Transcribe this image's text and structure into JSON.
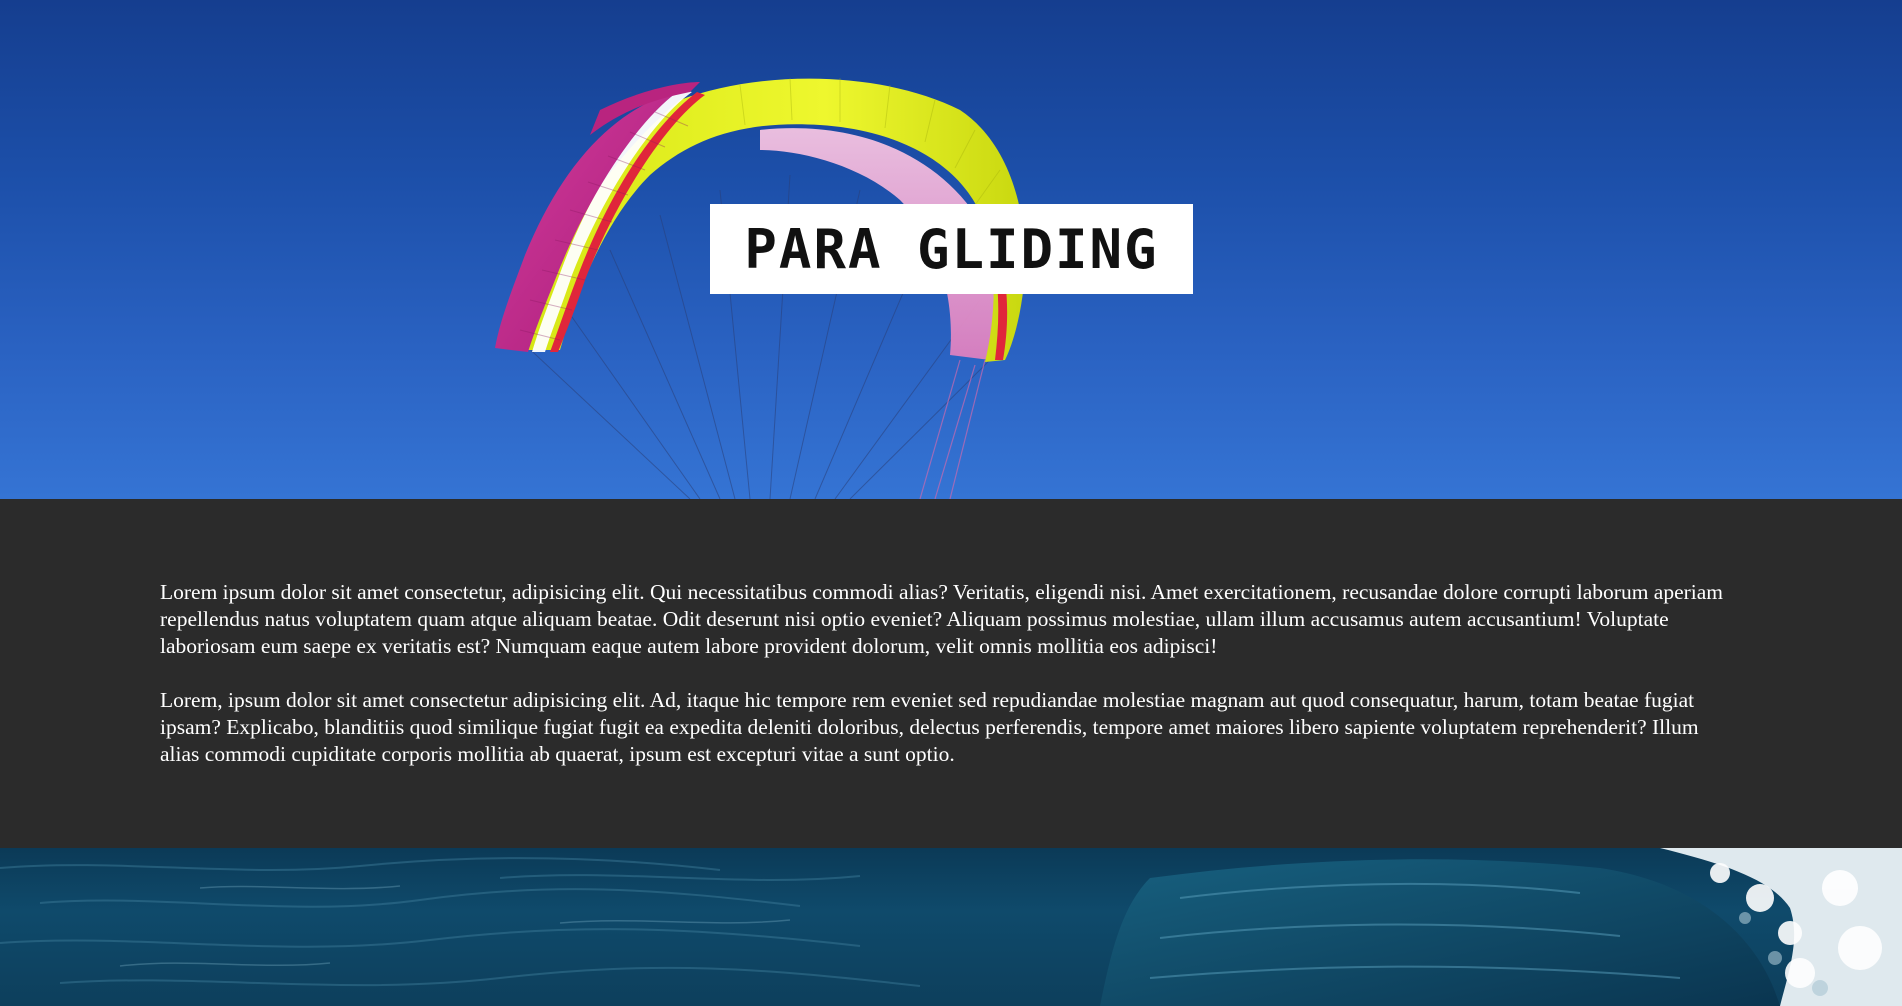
{
  "hero": {
    "title": "PARA GLIDING",
    "image_subject": "paraglider-wing-in-blue-sky"
  },
  "content": {
    "paragraphs": [
      "Lorem ipsum dolor sit amet consectetur, adipisicing elit. Qui necessitatibus commodi alias? Veritatis, eligendi nisi. Amet exercitationem, recusandae dolore corrupti laborum aperiam repellendus natus voluptatem quam atque aliquam beatae. Odit deserunt nisi optio eveniet? Aliquam possimus molestiae, ullam illum accusamus autem accusantium! Voluptate laboriosam eum saepe ex veritatis est? Numquam eaque autem labore provident dolorum, velit omnis mollitia eos adipisci!",
      "Lorem, ipsum dolor sit amet consectetur adipisicing elit. Ad, itaque hic tempore rem eveniet sed repudiandae molestiae magnam aut quod consequatur, harum, totam beatae fugiat ipsam? Explicabo, blanditiis quod similique fugiat fugit ea expedita deleniti doloribus, delectus perferendis, tempore amet maiores libero sapiente voluptatem reprehenderit? Illum alias commodi cupiditate corporis mollitia ab quaerat, ipsum est excepturi vitae a sunt optio."
    ]
  },
  "ocean": {
    "image_subject": "ocean-wave"
  },
  "colors": {
    "sky_top": "#153e8f",
    "sky_bottom": "#3574d4",
    "content_background": "#2b2b2b",
    "content_text": "#ffffff",
    "title_box": "#ffffff",
    "title_text": "#111111",
    "ocean": "#0f4a6b",
    "wing_magenta": "#c2288e",
    "wing_yellow": "#e3f21c",
    "wing_red": "#e0263b"
  }
}
